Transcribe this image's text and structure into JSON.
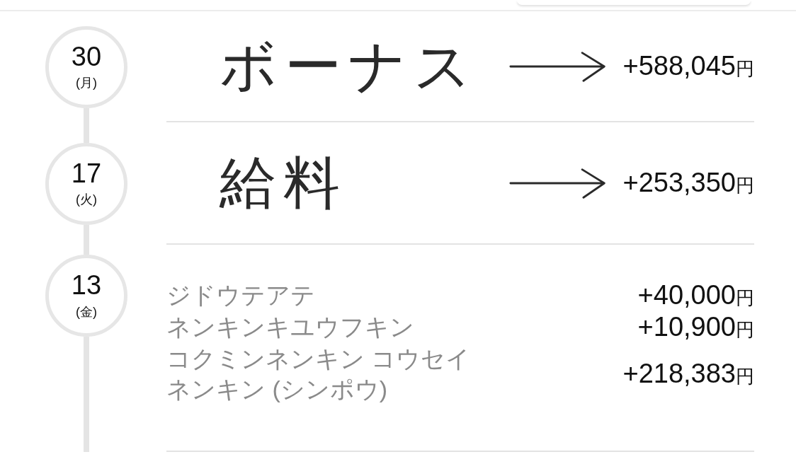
{
  "entries": [
    {
      "kind": "note",
      "day": "30",
      "weekday": "(月)",
      "note": "ボーナス",
      "amount": "+588,045",
      "currency": "円"
    },
    {
      "kind": "note",
      "day": "17",
      "weekday": "(火)",
      "note": "給料",
      "amount": "+253,350",
      "currency": "円"
    },
    {
      "kind": "items",
      "day": "13",
      "weekday": "(金)",
      "items": [
        {
          "name": "ジドウテアテ",
          "amount": "+40,000",
          "currency": "円"
        },
        {
          "name": "ネンキンキユウフキン",
          "amount": "+10,900",
          "currency": "円"
        },
        {
          "name": "コクミンネンキン コウセイネンキン (シンポウ)",
          "amount": "+218,383",
          "currency": "円"
        }
      ]
    }
  ]
}
